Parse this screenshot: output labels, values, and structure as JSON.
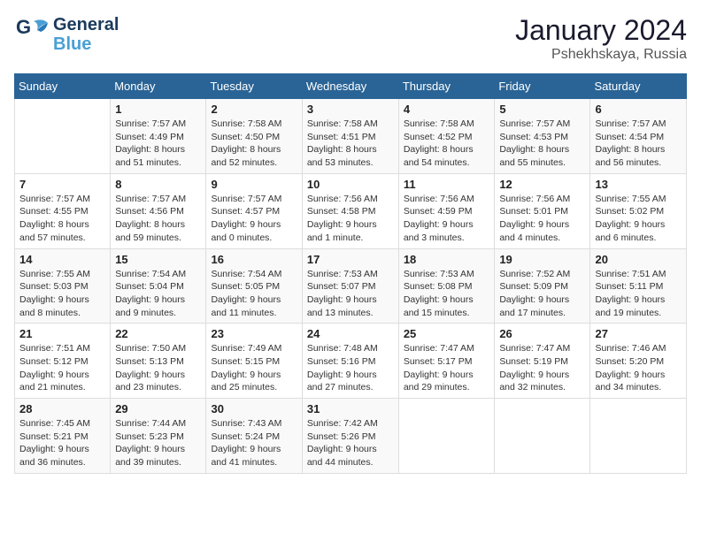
{
  "header": {
    "logo_line1": "General",
    "logo_line2": "Blue",
    "title": "January 2024",
    "subtitle": "Pshekhskaya, Russia"
  },
  "calendar": {
    "headers": [
      "Sunday",
      "Monday",
      "Tuesday",
      "Wednesday",
      "Thursday",
      "Friday",
      "Saturday"
    ],
    "weeks": [
      [
        {
          "day": "",
          "sunrise": "",
          "sunset": "",
          "daylight": ""
        },
        {
          "day": "1",
          "sunrise": "Sunrise: 7:57 AM",
          "sunset": "Sunset: 4:49 PM",
          "daylight": "Daylight: 8 hours and 51 minutes."
        },
        {
          "day": "2",
          "sunrise": "Sunrise: 7:58 AM",
          "sunset": "Sunset: 4:50 PM",
          "daylight": "Daylight: 8 hours and 52 minutes."
        },
        {
          "day": "3",
          "sunrise": "Sunrise: 7:58 AM",
          "sunset": "Sunset: 4:51 PM",
          "daylight": "Daylight: 8 hours and 53 minutes."
        },
        {
          "day": "4",
          "sunrise": "Sunrise: 7:58 AM",
          "sunset": "Sunset: 4:52 PM",
          "daylight": "Daylight: 8 hours and 54 minutes."
        },
        {
          "day": "5",
          "sunrise": "Sunrise: 7:57 AM",
          "sunset": "Sunset: 4:53 PM",
          "daylight": "Daylight: 8 hours and 55 minutes."
        },
        {
          "day": "6",
          "sunrise": "Sunrise: 7:57 AM",
          "sunset": "Sunset: 4:54 PM",
          "daylight": "Daylight: 8 hours and 56 minutes."
        }
      ],
      [
        {
          "day": "7",
          "sunrise": "Sunrise: 7:57 AM",
          "sunset": "Sunset: 4:55 PM",
          "daylight": "Daylight: 8 hours and 57 minutes."
        },
        {
          "day": "8",
          "sunrise": "Sunrise: 7:57 AM",
          "sunset": "Sunset: 4:56 PM",
          "daylight": "Daylight: 8 hours and 59 minutes."
        },
        {
          "day": "9",
          "sunrise": "Sunrise: 7:57 AM",
          "sunset": "Sunset: 4:57 PM",
          "daylight": "Daylight: 9 hours and 0 minutes."
        },
        {
          "day": "10",
          "sunrise": "Sunrise: 7:56 AM",
          "sunset": "Sunset: 4:58 PM",
          "daylight": "Daylight: 9 hours and 1 minute."
        },
        {
          "day": "11",
          "sunrise": "Sunrise: 7:56 AM",
          "sunset": "Sunset: 4:59 PM",
          "daylight": "Daylight: 9 hours and 3 minutes."
        },
        {
          "day": "12",
          "sunrise": "Sunrise: 7:56 AM",
          "sunset": "Sunset: 5:01 PM",
          "daylight": "Daylight: 9 hours and 4 minutes."
        },
        {
          "day": "13",
          "sunrise": "Sunrise: 7:55 AM",
          "sunset": "Sunset: 5:02 PM",
          "daylight": "Daylight: 9 hours and 6 minutes."
        }
      ],
      [
        {
          "day": "14",
          "sunrise": "Sunrise: 7:55 AM",
          "sunset": "Sunset: 5:03 PM",
          "daylight": "Daylight: 9 hours and 8 minutes."
        },
        {
          "day": "15",
          "sunrise": "Sunrise: 7:54 AM",
          "sunset": "Sunset: 5:04 PM",
          "daylight": "Daylight: 9 hours and 9 minutes."
        },
        {
          "day": "16",
          "sunrise": "Sunrise: 7:54 AM",
          "sunset": "Sunset: 5:05 PM",
          "daylight": "Daylight: 9 hours and 11 minutes."
        },
        {
          "day": "17",
          "sunrise": "Sunrise: 7:53 AM",
          "sunset": "Sunset: 5:07 PM",
          "daylight": "Daylight: 9 hours and 13 minutes."
        },
        {
          "day": "18",
          "sunrise": "Sunrise: 7:53 AM",
          "sunset": "Sunset: 5:08 PM",
          "daylight": "Daylight: 9 hours and 15 minutes."
        },
        {
          "day": "19",
          "sunrise": "Sunrise: 7:52 AM",
          "sunset": "Sunset: 5:09 PM",
          "daylight": "Daylight: 9 hours and 17 minutes."
        },
        {
          "day": "20",
          "sunrise": "Sunrise: 7:51 AM",
          "sunset": "Sunset: 5:11 PM",
          "daylight": "Daylight: 9 hours and 19 minutes."
        }
      ],
      [
        {
          "day": "21",
          "sunrise": "Sunrise: 7:51 AM",
          "sunset": "Sunset: 5:12 PM",
          "daylight": "Daylight: 9 hours and 21 minutes."
        },
        {
          "day": "22",
          "sunrise": "Sunrise: 7:50 AM",
          "sunset": "Sunset: 5:13 PM",
          "daylight": "Daylight: 9 hours and 23 minutes."
        },
        {
          "day": "23",
          "sunrise": "Sunrise: 7:49 AM",
          "sunset": "Sunset: 5:15 PM",
          "daylight": "Daylight: 9 hours and 25 minutes."
        },
        {
          "day": "24",
          "sunrise": "Sunrise: 7:48 AM",
          "sunset": "Sunset: 5:16 PM",
          "daylight": "Daylight: 9 hours and 27 minutes."
        },
        {
          "day": "25",
          "sunrise": "Sunrise: 7:47 AM",
          "sunset": "Sunset: 5:17 PM",
          "daylight": "Daylight: 9 hours and 29 minutes."
        },
        {
          "day": "26",
          "sunrise": "Sunrise: 7:47 AM",
          "sunset": "Sunset: 5:19 PM",
          "daylight": "Daylight: 9 hours and 32 minutes."
        },
        {
          "day": "27",
          "sunrise": "Sunrise: 7:46 AM",
          "sunset": "Sunset: 5:20 PM",
          "daylight": "Daylight: 9 hours and 34 minutes."
        }
      ],
      [
        {
          "day": "28",
          "sunrise": "Sunrise: 7:45 AM",
          "sunset": "Sunset: 5:21 PM",
          "daylight": "Daylight: 9 hours and 36 minutes."
        },
        {
          "day": "29",
          "sunrise": "Sunrise: 7:44 AM",
          "sunset": "Sunset: 5:23 PM",
          "daylight": "Daylight: 9 hours and 39 minutes."
        },
        {
          "day": "30",
          "sunrise": "Sunrise: 7:43 AM",
          "sunset": "Sunset: 5:24 PM",
          "daylight": "Daylight: 9 hours and 41 minutes."
        },
        {
          "day": "31",
          "sunrise": "Sunrise: 7:42 AM",
          "sunset": "Sunset: 5:26 PM",
          "daylight": "Daylight: 9 hours and 44 minutes."
        },
        {
          "day": "",
          "sunrise": "",
          "sunset": "",
          "daylight": ""
        },
        {
          "day": "",
          "sunrise": "",
          "sunset": "",
          "daylight": ""
        },
        {
          "day": "",
          "sunrise": "",
          "sunset": "",
          "daylight": ""
        }
      ]
    ]
  }
}
